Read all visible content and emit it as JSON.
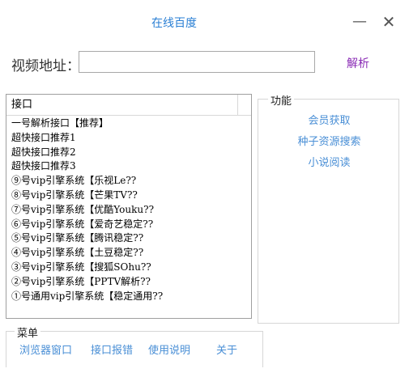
{
  "window": {
    "title": "在线百度",
    "minimize_glyph": "—",
    "close_glyph": "✕"
  },
  "url_bar": {
    "label": "视频地址：",
    "value": "",
    "parse_label": "解析"
  },
  "interface_list": {
    "header": "接口",
    "items": [
      "一号解析接口【推荐】",
      "超快接口推荐1",
      "超快接口推荐2",
      "超快接口推荐3",
      "⑨号vip引擎系统【乐视Le??",
      "⑧号vip引擎系统【芒果TV??",
      "⑦号vip引擎系统【优酷Youku??",
      "⑥号vip引擎系统【爱奇艺稳定??",
      "⑤号vip引擎系统【腾讯稳定??",
      "④号vip引擎系统【土豆稳定??",
      "③号vip引擎系统【搜狐SOhu??",
      "②号vip引擎系统【PPTV解析??",
      "①号通用vip引擎系统【稳定通用??"
    ]
  },
  "functions": {
    "legend": "功能",
    "links": [
      "会员获取",
      "种子资源搜索",
      "小说阅读"
    ]
  },
  "menu": {
    "legend": "菜单",
    "links": [
      "浏览器窗口",
      "接口报错",
      "使用说明",
      "关于"
    ]
  },
  "colors": {
    "title": "#2a7fd4",
    "link": "#4a8fd6",
    "parse": "#8a2bb5"
  }
}
